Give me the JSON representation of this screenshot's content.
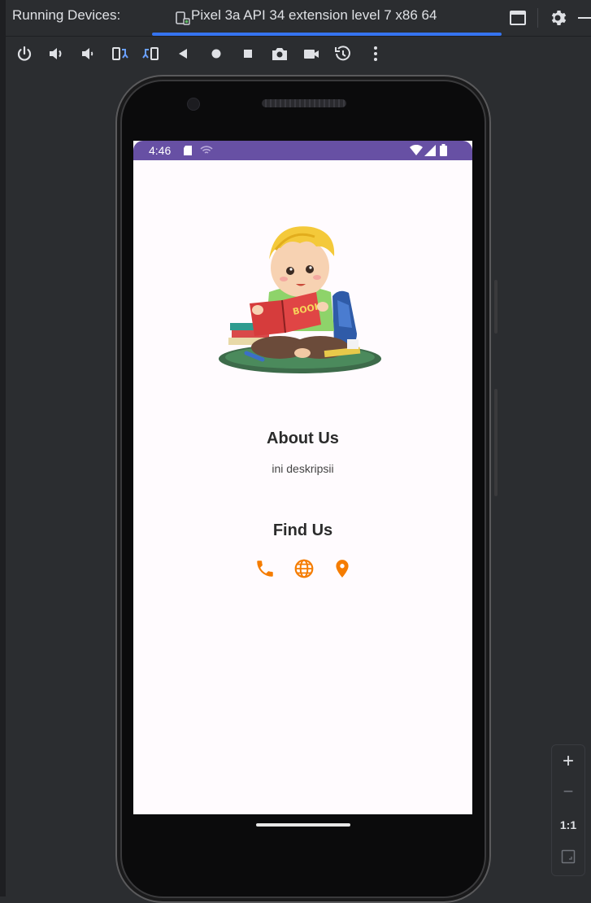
{
  "window": {
    "title": "Running Devices:",
    "tab_label": "Pixel 3a API 34 extension level 7 x86 64"
  },
  "toolbar": {
    "icons": [
      "power-icon",
      "volume-up-icon",
      "volume-down-icon",
      "rotate-left-icon",
      "rotate-right-icon",
      "back-icon",
      "home-icon",
      "overview-icon",
      "screenshot-icon",
      "screen-record-icon",
      "snapshot-icon",
      "more-icon"
    ]
  },
  "device": {
    "status_bar": {
      "time": "4:46",
      "color": "#6750a4"
    },
    "about": {
      "title": "About Us",
      "description": "ini deskripsii"
    },
    "find": {
      "title": "Find Us",
      "icons": [
        "phone-icon",
        "globe-icon",
        "location-pin-icon"
      ],
      "icon_color": "#f57c00"
    }
  },
  "zoom": {
    "zoom_in": "+",
    "zoom_out": "−",
    "actual_size": "1:1"
  }
}
